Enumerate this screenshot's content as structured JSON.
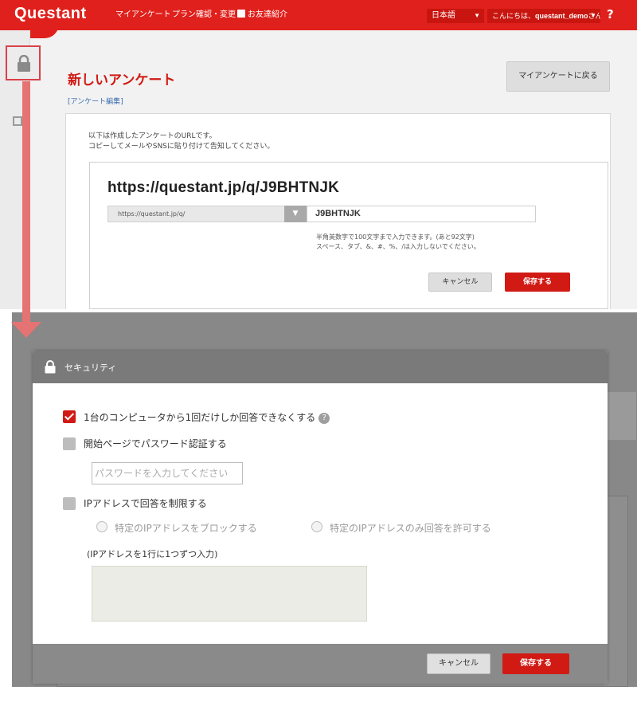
{
  "top_page": {
    "logo": "Questant",
    "nav": {
      "my_surveys": "マイアンケート",
      "plan": "プラン確認・変更",
      "referral": "お友達紹介"
    },
    "language": "日本語",
    "greeting_prefix": "こんにちは、",
    "username": "questant_demo",
    "greeting_suffix": "さん",
    "help": "?",
    "page_title": "新しいアンケート",
    "edit_link": "[アンケート編集]",
    "back_button": "マイアンケートに戻る",
    "description_line1": "以下は作成したアンケートのURLです。",
    "description_line2": "コピーしてメールやSNSに貼り付けて告知してください。",
    "full_url": "https://questant.jp/q/J9BHTNJK",
    "base_url_option": "https://questant.jp/q/",
    "slug_value": "J9BHTNJK",
    "hint_line1": "半角英数字で100文字まで入力できます。(あと92文字)",
    "hint_line2": "スペース、タブ、&、#、%、/は入力しないでください。",
    "cancel_label": "キャンセル",
    "save_label": "保存する"
  },
  "modal": {
    "title": "セキュリティ",
    "options": {
      "single_answer": {
        "label": "1台のコンピュータから1回だけしか回答できなくする",
        "checked": true
      },
      "password": {
        "label": "開始ページでパスワード認証する",
        "checked": false,
        "placeholder": "パスワードを入力してください"
      },
      "ip_restrict": {
        "label": "IPアドレスで回答を制限する",
        "checked": false
      }
    },
    "radio_block": "特定のIPアドレスをブロックする",
    "radio_allow": "特定のIPアドレスのみ回答を許可する",
    "ip_input_label": "(IPアドレスを1行に1つずつ入力)",
    "help_icon": "?",
    "cancel_label": "キャンセル",
    "save_label": "保存する"
  },
  "colors": {
    "brand_red": "#e0201c",
    "button_red": "#d11a14",
    "annotation_red": "#e57373"
  },
  "icons": [
    "lock-icon",
    "gift-icon",
    "chevron-down-icon",
    "help-icon",
    "arrow-down-icon"
  ]
}
